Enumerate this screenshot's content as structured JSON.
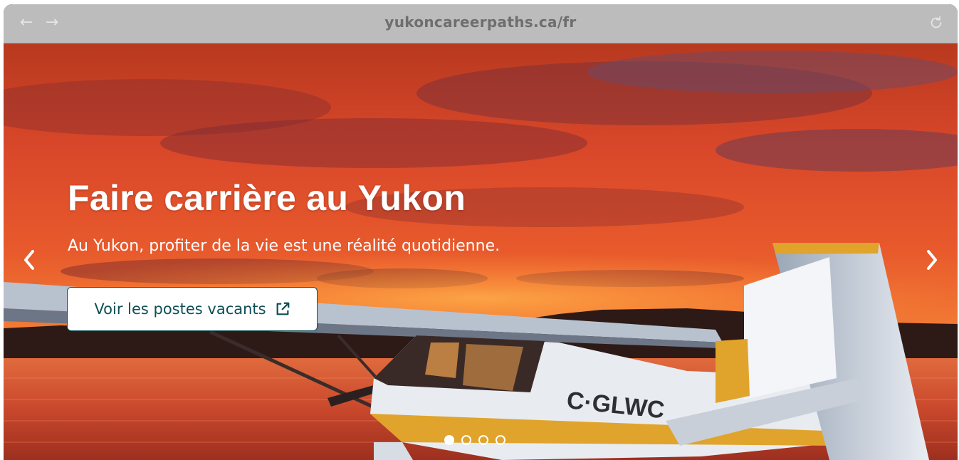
{
  "browser": {
    "url": "yukoncareerpaths.ca/fr",
    "back_icon": "arrow-left-icon",
    "forward_icon": "arrow-right-icon",
    "reload_icon": "reload-icon"
  },
  "hero": {
    "title": "Faire carrière au Yukon",
    "subtitle": "Au Yukon, profiter de la vie est une réalité quotidienne.",
    "cta_label": "Voir les postes vacants",
    "cta_icon": "external-link-icon",
    "prev_icon": "chevron-left-icon",
    "next_icon": "chevron-right-icon",
    "plane_registration": "C-GLWC",
    "slides": {
      "count": 4,
      "active": 1
    }
  },
  "colors": {
    "accent": "#0d4f55",
    "toolbar": "#bdbcbd",
    "sky_top": "#e0502a",
    "sky_glow": "#ff7a2e"
  }
}
